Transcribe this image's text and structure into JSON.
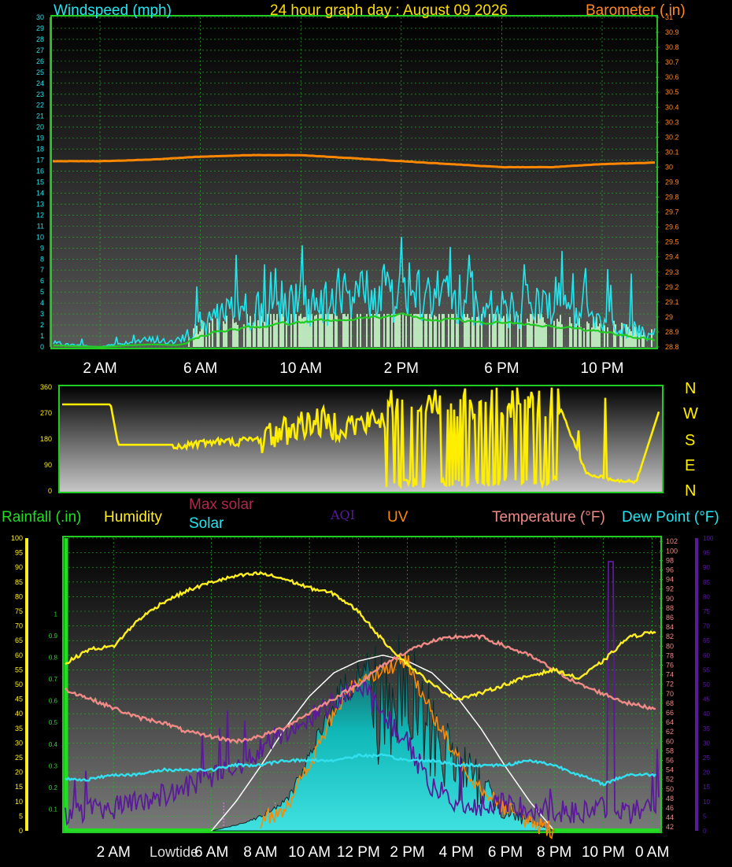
{
  "header": {
    "left_title": "Windspeed (mph)",
    "center_title": "24 hour graph day : August 09 2026",
    "right_title": "Barometer (.in)"
  },
  "wind_panel": {
    "x_ticks": [
      "2 AM",
      "6 AM",
      "10 AM",
      "2 PM",
      "6 PM",
      "10 PM"
    ],
    "x_tick_hours": [
      2,
      6,
      10,
      14,
      18,
      22
    ],
    "left_axis_ticks": [
      "0",
      "1",
      "2",
      "3",
      "4",
      "5",
      "6",
      "7",
      "8",
      "9",
      "10",
      "11",
      "12",
      "13",
      "14",
      "15",
      "16",
      "17",
      "18",
      "19",
      "20",
      "21",
      "22",
      "23",
      "24",
      "25",
      "26",
      "27",
      "28",
      "29",
      "30"
    ],
    "right_axis_ticks": [
      "28.8",
      "28.9",
      "29",
      "29.1",
      "29.2",
      "29.3",
      "29.4",
      "29.5",
      "29.6",
      "29.7",
      "29.8",
      "29.9",
      "30",
      "30.1",
      "30.2",
      "30.3",
      "30.4",
      "30.5",
      "30.6",
      "30.7",
      "30.8",
      "30.9",
      "31"
    ]
  },
  "direction_panel": {
    "y_ticks": [
      "0",
      "90",
      "180",
      "270",
      "360"
    ],
    "compass_labels": [
      "N",
      "W",
      "S",
      "E",
      "N"
    ]
  },
  "bottom_panel": {
    "legend": {
      "rainfall": "Rainfall (.in)",
      "humidity": "Humidity",
      "max_solar": "Max solar",
      "solar": "Solar",
      "aqi": "AQI",
      "uv": "UV",
      "temperature": "Temperature (°F)",
      "dew_point": "Dew Point (°F)"
    },
    "x_ticks": [
      "2 AM",
      "6 AM",
      "8 AM",
      "10 AM",
      "12 PM",
      "2 PM",
      "4 PM",
      "6 PM",
      "8 PM",
      "10 PM",
      "0 AM"
    ],
    "x_tick_hours": [
      2,
      6,
      8,
      10,
      12,
      14,
      16,
      18,
      20,
      22,
      24
    ],
    "tide_label": "Lowtide",
    "left_axis_ticks": [
      "0",
      "5",
      "10",
      "15",
      "20",
      "25",
      "30",
      "35",
      "40",
      "45",
      "50",
      "55",
      "60",
      "65",
      "70",
      "75",
      "80",
      "85",
      "90",
      "95",
      "100"
    ],
    "rain_axis_ticks": [
      "0.1",
      "0.2",
      "0.3",
      "0.4",
      "0.5",
      "0.6",
      "0.7",
      "0.8",
      "0.9",
      "1"
    ],
    "temp_axis_ticks": [
      "42",
      "44",
      "46",
      "48",
      "50",
      "52",
      "54",
      "56",
      "58",
      "60",
      "62",
      "64",
      "66",
      "68",
      "70",
      "72",
      "74",
      "76",
      "78",
      "80",
      "82",
      "84",
      "86",
      "88",
      "90",
      "92",
      "94",
      "96",
      "98",
      "100",
      "102"
    ],
    "aqi_axis_ticks": [
      "0",
      "5",
      "10",
      "15",
      "20",
      "25",
      "30",
      "35",
      "40",
      "45",
      "50",
      "55",
      "60",
      "65",
      "70",
      "75",
      "80",
      "85",
      "90",
      "95",
      "100"
    ]
  },
  "colors": {
    "windspeed": "#22e5ee",
    "avg_wind": "#22cc22",
    "gust_fill": "#ccffcc",
    "barometer": "#ff8800",
    "direction": "#ffee00",
    "humidity": "#ffee22",
    "temperature": "#f08a86",
    "dew_point": "#33e0f0",
    "aqi": "#5a1a9a",
    "uv": "#ff8800",
    "max_solar": "#ffffff",
    "solar_fill": "#10c0c0",
    "grid": "#22bb22",
    "title_orange": "#ff8822",
    "title_yellow": "#ffdd00",
    "title_cyan": "#22e5ee"
  },
  "chart_data": [
    {
      "type": "line",
      "title": "24 hour graph day : August 09 2026",
      "series": [
        {
          "name": "Windspeed (mph)",
          "x": [
            0,
            1,
            2,
            3,
            4,
            5,
            6,
            7,
            8,
            9,
            10,
            11,
            12,
            13,
            14,
            15,
            16,
            17,
            18,
            19,
            20,
            21,
            22,
            23,
            24
          ],
          "values": [
            0.5,
            0.2,
            0,
            0.5,
            0.8,
            0.5,
            2.5,
            3.5,
            4,
            4.5,
            5,
            5.5,
            5.5,
            6,
            6.5,
            5.5,
            5.5,
            5,
            5,
            4.5,
            4,
            3.5,
            3,
            2,
            1.5
          ]
        },
        {
          "name": "Barometer (.in)",
          "x": [
            0,
            2,
            4,
            6,
            8,
            10,
            12,
            14,
            16,
            18,
            20,
            22,
            24
          ],
          "values": [
            30.04,
            30.04,
            30.05,
            30.07,
            30.08,
            30.08,
            30.06,
            30.04,
            30.02,
            30.0,
            30.0,
            30.02,
            30.03
          ]
        }
      ],
      "ylim": [
        0,
        30
      ],
      "ylim_right": [
        28.8,
        31
      ]
    },
    {
      "type": "line",
      "series": [
        {
          "name": "Wind direction",
          "x": [
            0,
            2,
            2.3,
            4,
            5,
            6,
            7,
            8,
            9,
            10,
            11,
            12,
            13,
            14,
            15,
            16,
            17,
            18,
            19,
            20,
            21,
            22,
            23,
            24
          ],
          "values": [
            300,
            300,
            160,
            160,
            160,
            170,
            170,
            180,
            210,
            240,
            230,
            230,
            250,
            290,
            300,
            330,
            310,
            300,
            320,
            280,
            60,
            40,
            30,
            300
          ]
        }
      ],
      "ylim": [
        0,
        360
      ]
    },
    {
      "type": "line",
      "series": [
        {
          "name": "Humidity",
          "x": [
            0,
            1,
            2,
            3,
            4,
            5,
            6,
            7,
            8,
            9,
            10,
            11,
            12,
            13,
            14,
            15,
            16,
            17,
            18,
            19,
            20,
            21,
            22,
            23,
            24
          ],
          "values": [
            57,
            62,
            63,
            72,
            78,
            82,
            85,
            87,
            88,
            86,
            83,
            81,
            75,
            65,
            57,
            50,
            45,
            47,
            50,
            53,
            55,
            52,
            58,
            66,
            68
          ]
        },
        {
          "name": "Temperature (°F)",
          "x": [
            0,
            1,
            2,
            3,
            4,
            5,
            6,
            7,
            8,
            9,
            10,
            11,
            12,
            13,
            14,
            15,
            16,
            17,
            18,
            19,
            20,
            21,
            22,
            23,
            24
          ],
          "values": [
            71,
            69,
            67,
            65,
            64,
            62,
            61,
            60,
            61,
            63,
            66,
            69,
            72,
            76,
            79,
            81,
            82,
            82,
            80,
            78,
            75,
            72,
            70,
            68,
            67
          ]
        },
        {
          "name": "Dew Point (°F)",
          "x": [
            0,
            1,
            2,
            3,
            4,
            5,
            6,
            7,
            8,
            9,
            10,
            11,
            12,
            13,
            14,
            15,
            16,
            17,
            18,
            19,
            20,
            21,
            22,
            23,
            24
          ],
          "values": [
            52,
            52,
            53,
            53,
            54,
            54,
            54,
            55,
            55,
            56,
            56,
            56,
            57,
            57,
            56,
            56,
            55,
            55,
            55,
            56,
            55,
            53,
            51,
            53,
            53
          ]
        },
        {
          "name": "AQI",
          "x": [
            0,
            1,
            2,
            3,
            4,
            5,
            6,
            7,
            8,
            9,
            10,
            11,
            12,
            13,
            14,
            15,
            16,
            17,
            18,
            19,
            20,
            21,
            22,
            23,
            24
          ],
          "values": [
            5,
            7,
            8,
            10,
            12,
            15,
            18,
            22,
            28,
            34,
            38,
            45,
            50,
            40,
            30,
            15,
            10,
            8,
            9,
            8,
            7,
            6,
            8,
            6,
            9
          ]
        },
        {
          "name": "Solar",
          "x": [
            6,
            7,
            8,
            9,
            10,
            11,
            12,
            13,
            14,
            15,
            16,
            17,
            18,
            19,
            20
          ],
          "values": [
            0,
            2,
            5,
            10,
            25,
            45,
            55,
            60,
            58,
            45,
            30,
            20,
            10,
            3,
            0
          ]
        },
        {
          "name": "Max solar",
          "x": [
            6,
            7,
            8,
            9,
            10,
            11,
            12,
            13,
            14,
            15,
            16,
            17,
            18,
            19,
            20
          ],
          "values": [
            0,
            10,
            22,
            35,
            46,
            54,
            58,
            60,
            58,
            54,
            46,
            35,
            22,
            10,
            0
          ]
        },
        {
          "name": "UV",
          "x": [
            6,
            8,
            9,
            10,
            11,
            12,
            13,
            14,
            15,
            16,
            17,
            18,
            19,
            20
          ],
          "values": [
            0,
            3,
            8,
            22,
            40,
            52,
            55,
            58,
            40,
            25,
            15,
            8,
            3,
            0
          ]
        },
        {
          "name": "Rainfall (.in)",
          "x": [
            0,
            24
          ],
          "values": [
            0,
            0
          ]
        }
      ],
      "ylim": [
        0,
        100
      ],
      "ylim_temp": [
        42,
        102
      ]
    }
  ]
}
